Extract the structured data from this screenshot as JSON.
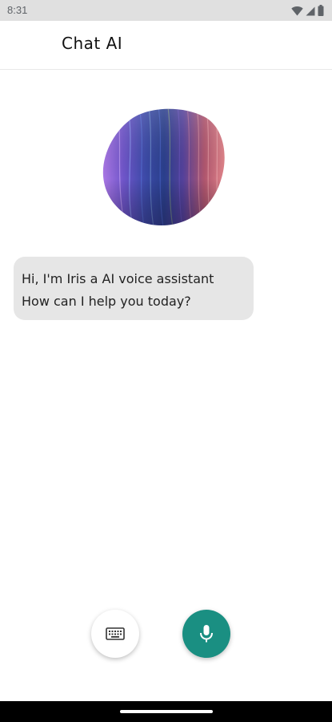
{
  "status_bar": {
    "time": "8:31",
    "icons": [
      "wifi-icon",
      "signal-icon",
      "battery-icon"
    ]
  },
  "app_bar": {
    "title": "Chat AI"
  },
  "assistant_avatar": {
    "icon": "ai-orb"
  },
  "messages": [
    {
      "sender": "assistant",
      "lines": [
        "Hi, I'm Iris a AI voice assistant",
        " How can I help you today?"
      ]
    }
  ],
  "actions": {
    "keyboard_icon": "keyboard-icon",
    "mic_icon": "mic-icon"
  },
  "colors": {
    "accent": "#1a8f82",
    "bubble": "#e6e6e6",
    "status_bar": "#e0e0e0"
  }
}
